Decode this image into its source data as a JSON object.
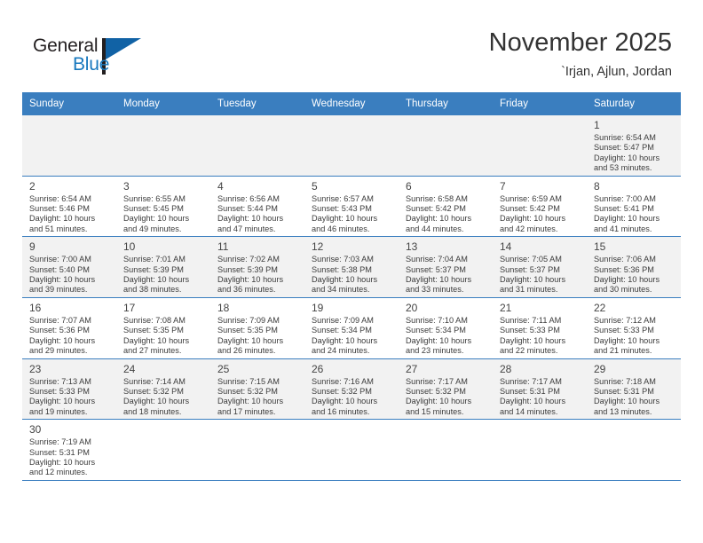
{
  "brand": {
    "name_part1": "General",
    "name_part2": "Blue",
    "triangle_color": "#1162a5",
    "blue_text_color": "#1878be"
  },
  "header": {
    "title": "November 2025",
    "subtitle": "`Irjan, Ajlun, Jordan"
  },
  "theme": {
    "header_bg": "#3a7ebf",
    "header_text": "#ffffff",
    "alt_cell_bg": "#f2f2f2",
    "cell_bg": "#ffffff",
    "border": "#3a7ebf"
  },
  "weekdays": [
    "Sunday",
    "Monday",
    "Tuesday",
    "Wednesday",
    "Thursday",
    "Friday",
    "Saturday"
  ],
  "weeks": [
    [
      {
        "day": "",
        "sunrise": "",
        "sunset": "",
        "daylight1": "",
        "daylight2": ""
      },
      {
        "day": "",
        "sunrise": "",
        "sunset": "",
        "daylight1": "",
        "daylight2": ""
      },
      {
        "day": "",
        "sunrise": "",
        "sunset": "",
        "daylight1": "",
        "daylight2": ""
      },
      {
        "day": "",
        "sunrise": "",
        "sunset": "",
        "daylight1": "",
        "daylight2": ""
      },
      {
        "day": "",
        "sunrise": "",
        "sunset": "",
        "daylight1": "",
        "daylight2": ""
      },
      {
        "day": "",
        "sunrise": "",
        "sunset": "",
        "daylight1": "",
        "daylight2": ""
      },
      {
        "day": "1",
        "sunrise": "Sunrise: 6:54 AM",
        "sunset": "Sunset: 5:47 PM",
        "daylight1": "Daylight: 10 hours",
        "daylight2": "and 53 minutes."
      }
    ],
    [
      {
        "day": "2",
        "sunrise": "Sunrise: 6:54 AM",
        "sunset": "Sunset: 5:46 PM",
        "daylight1": "Daylight: 10 hours",
        "daylight2": "and 51 minutes."
      },
      {
        "day": "3",
        "sunrise": "Sunrise: 6:55 AM",
        "sunset": "Sunset: 5:45 PM",
        "daylight1": "Daylight: 10 hours",
        "daylight2": "and 49 minutes."
      },
      {
        "day": "4",
        "sunrise": "Sunrise: 6:56 AM",
        "sunset": "Sunset: 5:44 PM",
        "daylight1": "Daylight: 10 hours",
        "daylight2": "and 47 minutes."
      },
      {
        "day": "5",
        "sunrise": "Sunrise: 6:57 AM",
        "sunset": "Sunset: 5:43 PM",
        "daylight1": "Daylight: 10 hours",
        "daylight2": "and 46 minutes."
      },
      {
        "day": "6",
        "sunrise": "Sunrise: 6:58 AM",
        "sunset": "Sunset: 5:42 PM",
        "daylight1": "Daylight: 10 hours",
        "daylight2": "and 44 minutes."
      },
      {
        "day": "7",
        "sunrise": "Sunrise: 6:59 AM",
        "sunset": "Sunset: 5:42 PM",
        "daylight1": "Daylight: 10 hours",
        "daylight2": "and 42 minutes."
      },
      {
        "day": "8",
        "sunrise": "Sunrise: 7:00 AM",
        "sunset": "Sunset: 5:41 PM",
        "daylight1": "Daylight: 10 hours",
        "daylight2": "and 41 minutes."
      }
    ],
    [
      {
        "day": "9",
        "sunrise": "Sunrise: 7:00 AM",
        "sunset": "Sunset: 5:40 PM",
        "daylight1": "Daylight: 10 hours",
        "daylight2": "and 39 minutes."
      },
      {
        "day": "10",
        "sunrise": "Sunrise: 7:01 AM",
        "sunset": "Sunset: 5:39 PM",
        "daylight1": "Daylight: 10 hours",
        "daylight2": "and 38 minutes."
      },
      {
        "day": "11",
        "sunrise": "Sunrise: 7:02 AM",
        "sunset": "Sunset: 5:39 PM",
        "daylight1": "Daylight: 10 hours",
        "daylight2": "and 36 minutes."
      },
      {
        "day": "12",
        "sunrise": "Sunrise: 7:03 AM",
        "sunset": "Sunset: 5:38 PM",
        "daylight1": "Daylight: 10 hours",
        "daylight2": "and 34 minutes."
      },
      {
        "day": "13",
        "sunrise": "Sunrise: 7:04 AM",
        "sunset": "Sunset: 5:37 PM",
        "daylight1": "Daylight: 10 hours",
        "daylight2": "and 33 minutes."
      },
      {
        "day": "14",
        "sunrise": "Sunrise: 7:05 AM",
        "sunset": "Sunset: 5:37 PM",
        "daylight1": "Daylight: 10 hours",
        "daylight2": "and 31 minutes."
      },
      {
        "day": "15",
        "sunrise": "Sunrise: 7:06 AM",
        "sunset": "Sunset: 5:36 PM",
        "daylight1": "Daylight: 10 hours",
        "daylight2": "and 30 minutes."
      }
    ],
    [
      {
        "day": "16",
        "sunrise": "Sunrise: 7:07 AM",
        "sunset": "Sunset: 5:36 PM",
        "daylight1": "Daylight: 10 hours",
        "daylight2": "and 29 minutes."
      },
      {
        "day": "17",
        "sunrise": "Sunrise: 7:08 AM",
        "sunset": "Sunset: 5:35 PM",
        "daylight1": "Daylight: 10 hours",
        "daylight2": "and 27 minutes."
      },
      {
        "day": "18",
        "sunrise": "Sunrise: 7:09 AM",
        "sunset": "Sunset: 5:35 PM",
        "daylight1": "Daylight: 10 hours",
        "daylight2": "and 26 minutes."
      },
      {
        "day": "19",
        "sunrise": "Sunrise: 7:09 AM",
        "sunset": "Sunset: 5:34 PM",
        "daylight1": "Daylight: 10 hours",
        "daylight2": "and 24 minutes."
      },
      {
        "day": "20",
        "sunrise": "Sunrise: 7:10 AM",
        "sunset": "Sunset: 5:34 PM",
        "daylight1": "Daylight: 10 hours",
        "daylight2": "and 23 minutes."
      },
      {
        "day": "21",
        "sunrise": "Sunrise: 7:11 AM",
        "sunset": "Sunset: 5:33 PM",
        "daylight1": "Daylight: 10 hours",
        "daylight2": "and 22 minutes."
      },
      {
        "day": "22",
        "sunrise": "Sunrise: 7:12 AM",
        "sunset": "Sunset: 5:33 PM",
        "daylight1": "Daylight: 10 hours",
        "daylight2": "and 21 minutes."
      }
    ],
    [
      {
        "day": "23",
        "sunrise": "Sunrise: 7:13 AM",
        "sunset": "Sunset: 5:33 PM",
        "daylight1": "Daylight: 10 hours",
        "daylight2": "and 19 minutes."
      },
      {
        "day": "24",
        "sunrise": "Sunrise: 7:14 AM",
        "sunset": "Sunset: 5:32 PM",
        "daylight1": "Daylight: 10 hours",
        "daylight2": "and 18 minutes."
      },
      {
        "day": "25",
        "sunrise": "Sunrise: 7:15 AM",
        "sunset": "Sunset: 5:32 PM",
        "daylight1": "Daylight: 10 hours",
        "daylight2": "and 17 minutes."
      },
      {
        "day": "26",
        "sunrise": "Sunrise: 7:16 AM",
        "sunset": "Sunset: 5:32 PM",
        "daylight1": "Daylight: 10 hours",
        "daylight2": "and 16 minutes."
      },
      {
        "day": "27",
        "sunrise": "Sunrise: 7:17 AM",
        "sunset": "Sunset: 5:32 PM",
        "daylight1": "Daylight: 10 hours",
        "daylight2": "and 15 minutes."
      },
      {
        "day": "28",
        "sunrise": "Sunrise: 7:17 AM",
        "sunset": "Sunset: 5:31 PM",
        "daylight1": "Daylight: 10 hours",
        "daylight2": "and 14 minutes."
      },
      {
        "day": "29",
        "sunrise": "Sunrise: 7:18 AM",
        "sunset": "Sunset: 5:31 PM",
        "daylight1": "Daylight: 10 hours",
        "daylight2": "and 13 minutes."
      }
    ],
    [
      {
        "day": "30",
        "sunrise": "Sunrise: 7:19 AM",
        "sunset": "Sunset: 5:31 PM",
        "daylight1": "Daylight: 10 hours",
        "daylight2": "and 12 minutes."
      },
      {
        "day": "",
        "sunrise": "",
        "sunset": "",
        "daylight1": "",
        "daylight2": ""
      },
      {
        "day": "",
        "sunrise": "",
        "sunset": "",
        "daylight1": "",
        "daylight2": ""
      },
      {
        "day": "",
        "sunrise": "",
        "sunset": "",
        "daylight1": "",
        "daylight2": ""
      },
      {
        "day": "",
        "sunrise": "",
        "sunset": "",
        "daylight1": "",
        "daylight2": ""
      },
      {
        "day": "",
        "sunrise": "",
        "sunset": "",
        "daylight1": "",
        "daylight2": ""
      },
      {
        "day": "",
        "sunrise": "",
        "sunset": "",
        "daylight1": "",
        "daylight2": ""
      }
    ]
  ]
}
